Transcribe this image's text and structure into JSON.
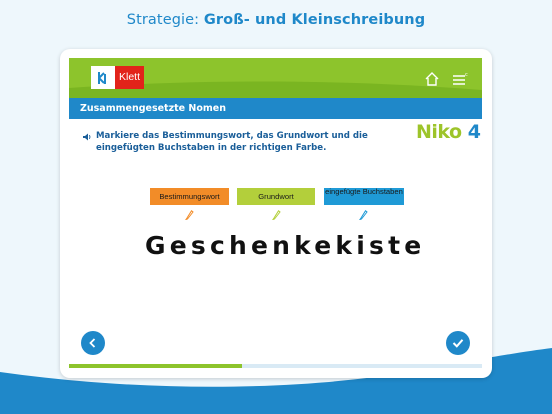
{
  "headline": {
    "prefix": "Strategie: ",
    "bold": "Groß- und Kleinschreibung"
  },
  "app": {
    "logo_text": "Klett",
    "title": "Zusammengesetzte Nomen",
    "brand": {
      "name": "Niko",
      "number": "4"
    }
  },
  "instruction": "Markiere das Bestimmungswort, das Grundwort und die eingefügten Buchstaben in der richtigen Farbe.",
  "markers": [
    {
      "label": "Bestimmungswort",
      "color": "#f28c28"
    },
    {
      "label": "Grundwort",
      "color": "#b3cf3b"
    },
    {
      "label": "eingefügte Buchstaben",
      "color": "#1f9ad6"
    }
  ],
  "word": "Geschenkekiste",
  "icons": [
    "home-icon",
    "menu-icon",
    "speaker-icon",
    "pencil-icon",
    "chevron-left-icon",
    "checkmark-icon"
  ],
  "colors": {
    "accent": "#1f88c9",
    "green": "#8dc42c",
    "red": "#e2231a"
  },
  "progress": 0.42
}
